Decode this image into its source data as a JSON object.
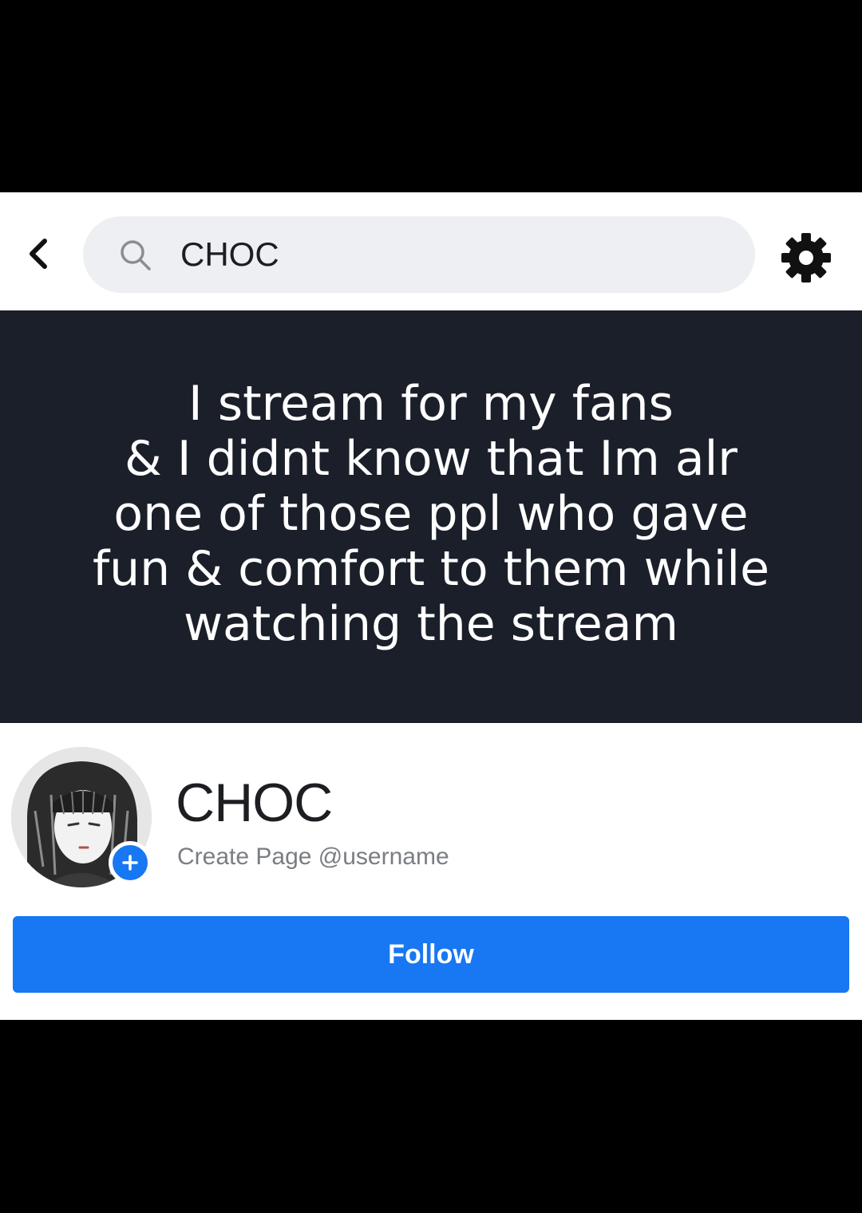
{
  "header": {
    "search_value": "CHOC",
    "back_icon": "chevron-left-icon",
    "search_icon": "search-icon",
    "settings_icon": "gear-icon"
  },
  "cover": {
    "lines": [
      "I stream for my fans",
      "& I didnt know that Im alr",
      "one of those ppl who gave",
      "fun & comfort to them while",
      "watching the stream"
    ]
  },
  "profile": {
    "name": "CHOC",
    "subtitle": "Create Page @username",
    "avatar_badge_icon": "plus-icon"
  },
  "actions": {
    "follow_label": "Follow"
  },
  "colors": {
    "accent": "#1877f2",
    "cover_bg": "#1b1f2a",
    "search_bg": "#eeeff2"
  }
}
